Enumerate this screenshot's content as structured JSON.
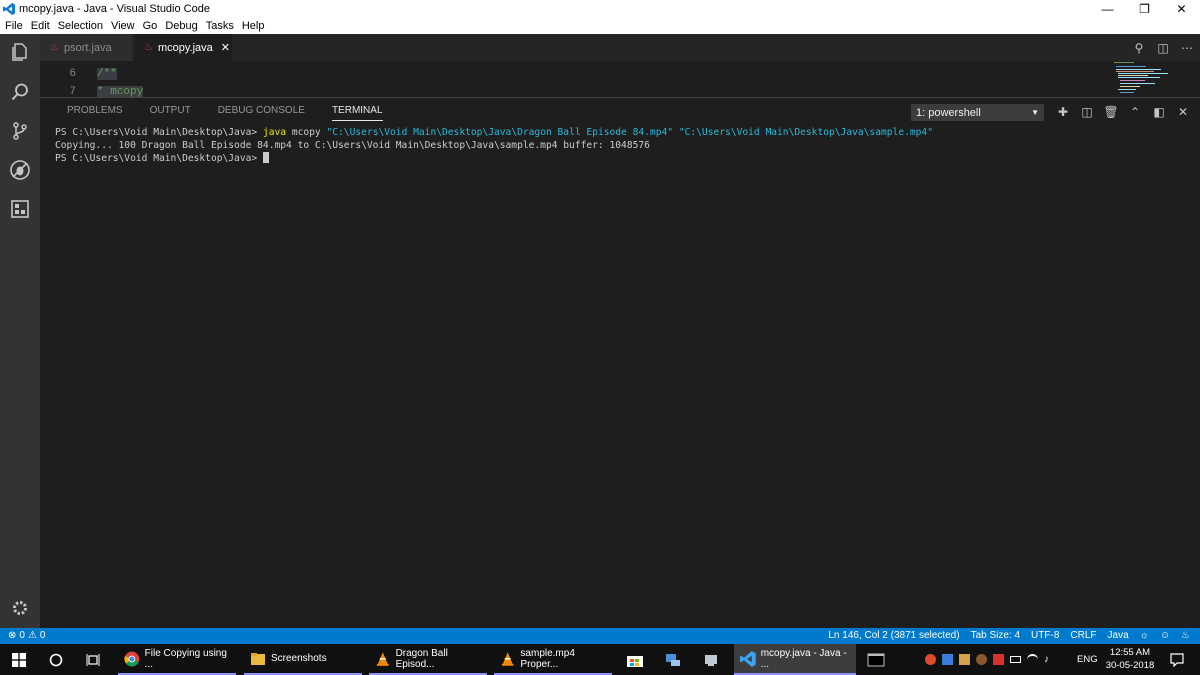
{
  "window": {
    "title": "mcopy.java - Java - Visual Studio Code",
    "controls": [
      "minimize",
      "restore",
      "close"
    ]
  },
  "menu": [
    "File",
    "Edit",
    "Selection",
    "View",
    "Go",
    "Debug",
    "Tasks",
    "Help"
  ],
  "activity_icons": [
    "files-icon",
    "search-icon",
    "source-control-icon",
    "debug-icon",
    "extensions-icon",
    "settings-icon"
  ],
  "tabs": [
    {
      "label": "psort.java",
      "active": false
    },
    {
      "label": "mcopy.java",
      "active": true,
      "close": "✕"
    }
  ],
  "editor": {
    "lines": [
      {
        "num": "6",
        "text": "/**"
      },
      {
        "num": "7",
        "text": " * mcopy"
      }
    ]
  },
  "panel": {
    "tabs": [
      "PROBLEMS",
      "OUTPUT",
      "DEBUG CONSOLE",
      "TERMINAL"
    ],
    "active_tab": "TERMINAL",
    "terminal_select": "1: powershell",
    "terminal": {
      "prompt1": "PS C:\\Users\\Void Main\\Desktop\\Java> ",
      "cmd": "java",
      "cmd_rest": " mcopy ",
      "arg1": "\"C:\\Users\\Void Main\\Desktop\\Java\\Dragon Ball Episode 84.mp4\"",
      "arg2": "\"C:\\Users\\Void Main\\Desktop\\Java\\sample.mp4\"",
      "output": "Copying... 100 Dragon Ball Episode 84.mp4 to C:\\Users\\Void Main\\Desktop\\Java\\sample.mp4 buffer: 1048576",
      "prompt2": "PS C:\\Users\\Void Main\\Desktop\\Java> "
    }
  },
  "status": {
    "errors": "0",
    "warnings": "0",
    "position": "Ln 146, Col 2 (3871 selected)",
    "tab_size": "Tab Size: 4",
    "encoding": "UTF-8",
    "eol": "CRLF",
    "language": "Java"
  },
  "taskbar": {
    "apps": [
      {
        "label": "File Copying using ...",
        "icon": "chrome-icon"
      },
      {
        "label": "Screenshots",
        "icon": "folder-icon"
      },
      {
        "label": "Dragon Ball Episod...",
        "icon": "vlc-icon"
      },
      {
        "label": "sample.mp4 Proper...",
        "icon": "vlc-icon"
      },
      {
        "label": "mcopy.java - Java - ...",
        "icon": "vscode-icon",
        "active": true
      }
    ],
    "lang": "ENG",
    "time": "12:55 AM",
    "date": "30-05-2018"
  },
  "colors": {
    "accent": "#007acc",
    "activity": "#333333",
    "editor_bg": "#1e1e1e",
    "terminal_cmd": "#e5e510",
    "terminal_str": "#29b8db"
  }
}
